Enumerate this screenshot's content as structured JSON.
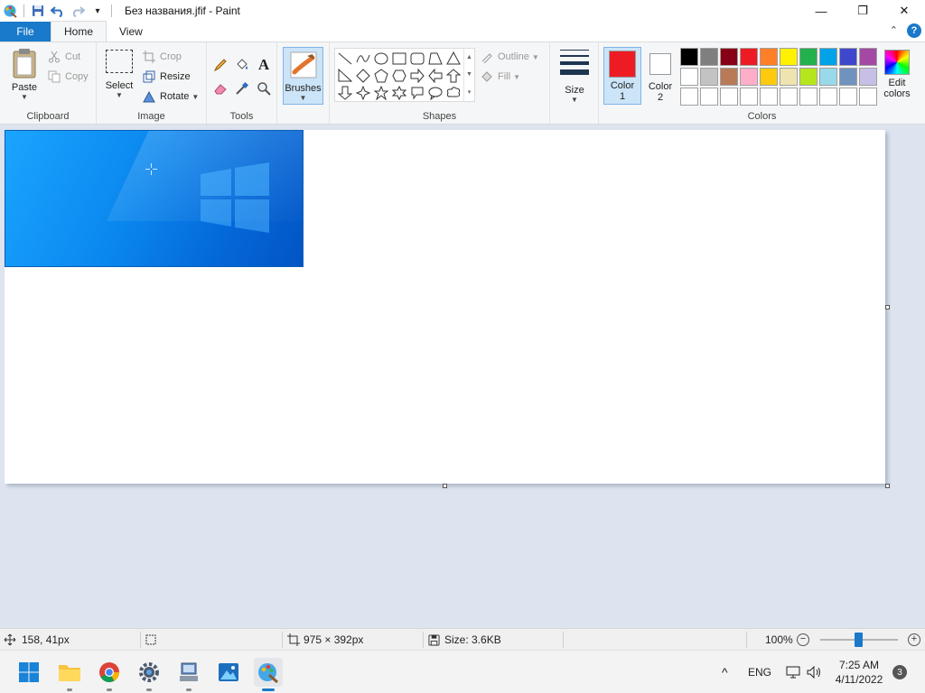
{
  "window": {
    "title": "Без названия.jfif - Paint",
    "controls": {
      "minimize": "—",
      "maximize": "❐",
      "close": "✕"
    }
  },
  "tabs": [
    {
      "label": "File"
    },
    {
      "label": "Home"
    },
    {
      "label": "View"
    }
  ],
  "help_label": "?",
  "ribbon": {
    "clipboard": {
      "group_label": "Clipboard",
      "paste": "Paste",
      "cut": "Cut",
      "copy": "Copy"
    },
    "image": {
      "group_label": "Image",
      "select": "Select",
      "crop": "Crop",
      "resize": "Resize",
      "rotate": "Rotate"
    },
    "tools": {
      "group_label": "Tools",
      "text_tool": "A"
    },
    "brushes": {
      "label": "Brushes"
    },
    "shapes": {
      "group_label": "Shapes",
      "outline": "Outline",
      "fill": "Fill"
    },
    "size": {
      "label": "Size"
    },
    "colors": {
      "group_label": "Colors",
      "color1_label": "Color 1",
      "color1_line1": "Color",
      "color1_line2": "1",
      "color2_line1": "Color",
      "color2_line2": "2",
      "color1_value": "#ed1c24",
      "color2_value": "#ffffff",
      "edit_line1": "Edit",
      "edit_line2": "colors",
      "palette_row1": [
        "#000000",
        "#7f7f7f",
        "#880015",
        "#ed1c24",
        "#ff7f27",
        "#fff200",
        "#22b14c",
        "#00a2e8",
        "#3f48cc",
        "#a349a4"
      ],
      "palette_row2": [
        "#ffffff",
        "#c3c3c3",
        "#b97a57",
        "#ffaec9",
        "#ffc90e",
        "#efe4b0",
        "#b5e61d",
        "#99d9ea",
        "#7092be",
        "#c8bfe7"
      ],
      "palette_row3": [
        "#ffffff",
        "#ffffff",
        "#ffffff",
        "#ffffff",
        "#ffffff",
        "#ffffff",
        "#ffffff",
        "#ffffff",
        "#ffffff",
        "#ffffff"
      ]
    }
  },
  "canvas": {
    "background": "#ffffff"
  },
  "status": {
    "cursor_pos": "158, 41px",
    "image_size": "975 × 392px",
    "file_size": "Size: 3.6KB",
    "zoom": "100%",
    "zoom_out": "−",
    "zoom_in": "+"
  },
  "taskbar": {
    "apps": [
      "start",
      "file-explorer",
      "chrome",
      "settings",
      "network-app",
      "photos",
      "paint"
    ],
    "tray_chevron": "^",
    "language": "ENG",
    "time": "7:25 AM",
    "date": "4/11/2022",
    "notifications": "3"
  }
}
